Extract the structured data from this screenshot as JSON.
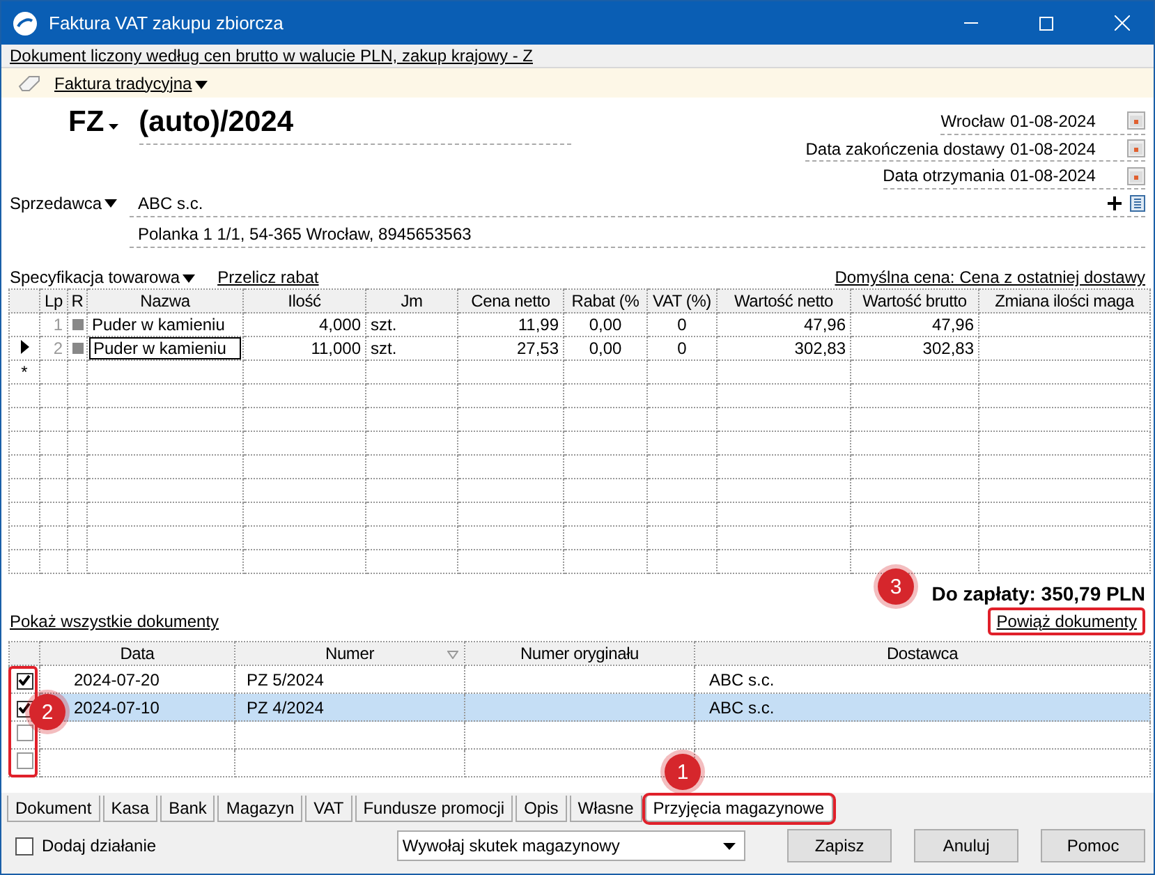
{
  "window": {
    "title": "Faktura VAT zakupu zbiorcza"
  },
  "info_bar": "Dokument liczony według cen brutto w walucie PLN, zakup krajowy - Z",
  "doc_type": "Faktura tradycyjna",
  "doc_number": {
    "prefix": "FZ",
    "number": "(auto)/2024"
  },
  "dates": [
    {
      "label": "Wrocław",
      "value": "01-08-2024"
    },
    {
      "label": "Data zakończenia dostawy",
      "value": "01-08-2024"
    },
    {
      "label": "Data otrzymania",
      "value": "01-08-2024"
    }
  ],
  "seller": {
    "label": "Sprzedawca",
    "name": "ABC s.c.",
    "address": "Polanka 1 1/1, 54-365 Wrocław, 8945653563"
  },
  "spec": {
    "label": "Specyfikacja towarowa",
    "recalc_link": "Przelicz rabat",
    "default_price": "Domyślna cena: Cena z ostatniej dostawy"
  },
  "items": {
    "columns": [
      "Lp",
      "R",
      "Nazwa",
      "Ilość",
      "Jm",
      "Cena netto",
      "Rabat (%",
      "VAT (%)",
      "Wartość netto",
      "Wartość brutto",
      "Zmiana ilości maga"
    ],
    "rows": [
      {
        "selected": false,
        "cells": [
          "1",
          "",
          "Puder w kamieniu",
          "4,000",
          "szt.",
          "11,99",
          "0,00",
          "0",
          "47,96",
          "47,96",
          ""
        ]
      },
      {
        "selected": true,
        "cells": [
          "2",
          "",
          "Puder w kamieniu",
          "11,000",
          "szt.",
          "27,53",
          "0,00",
          "0",
          "302,83",
          "302,83",
          ""
        ]
      }
    ],
    "new_row_marker": "*"
  },
  "total": "Do zapłaty: 350,79 PLN",
  "documents": {
    "show_all_link": "Pokaż wszystkie dokumenty",
    "link_button": {
      "label": "Powiąż dokumenty",
      "highlighted": true,
      "callout": "3"
    },
    "checkbox_highlighted": true,
    "callout": "2",
    "columns": [
      "Data",
      "Numer",
      "Numer oryginału",
      "Dostawca"
    ],
    "rows": [
      {
        "checked": true,
        "selected": false,
        "cells": [
          "2024-07-20",
          "PZ 5/2024",
          "",
          "ABC s.c."
        ]
      },
      {
        "checked": true,
        "selected": true,
        "cells": [
          "2024-07-10",
          "PZ 4/2024",
          "",
          "ABC s.c."
        ]
      },
      {
        "checked": false,
        "selected": false,
        "cells": [
          "",
          "",
          "",
          ""
        ]
      },
      {
        "checked": false,
        "selected": false,
        "cells": [
          "",
          "",
          "",
          ""
        ]
      }
    ]
  },
  "tabs": [
    {
      "label": "Dokument",
      "selected": false,
      "highlighted": false
    },
    {
      "label": "Kasa",
      "selected": false,
      "highlighted": false
    },
    {
      "label": "Bank",
      "selected": false,
      "highlighted": false
    },
    {
      "label": "Magazyn",
      "selected": false,
      "highlighted": false
    },
    {
      "label": "VAT",
      "selected": false,
      "highlighted": false
    },
    {
      "label": "Fundusze promocji",
      "selected": false,
      "highlighted": false
    },
    {
      "label": "Opis",
      "selected": false,
      "highlighted": false
    },
    {
      "label": "Własne",
      "selected": false,
      "highlighted": false
    },
    {
      "label": "Przyjęcia magazynowe",
      "selected": true,
      "highlighted": true,
      "callout": "1"
    }
  ],
  "add_action": {
    "label": "Dodaj działanie",
    "checked": false
  },
  "action_select": "Wywołaj skutek magazynowy",
  "buttons": [
    "Zapisz",
    "Anuluj",
    "Pomoc"
  ]
}
